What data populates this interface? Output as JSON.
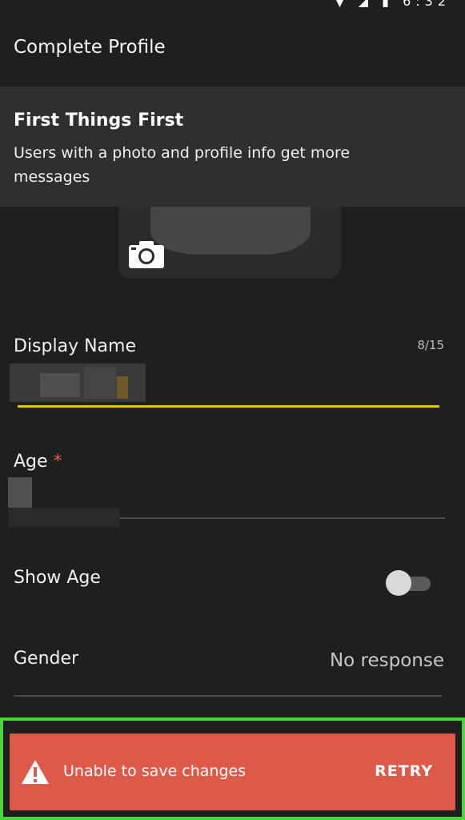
{
  "status_bar": {
    "time": "6:32"
  },
  "header": {
    "title": "Complete Profile"
  },
  "banner": {
    "heading": "First Things First",
    "subtext": "Users with a photo and profile info get more messages"
  },
  "form": {
    "display_name": {
      "label": "Display Name",
      "counter": "8/15"
    },
    "age": {
      "label": "Age",
      "required_mark": "*"
    },
    "show_age": {
      "label": "Show Age",
      "enabled": false
    },
    "gender": {
      "label": "Gender",
      "value": "No response"
    }
  },
  "snackbar": {
    "message": "Unable to save changes",
    "action": "RETRY",
    "background_color": "#dd5a4b"
  },
  "colors": {
    "accent": "#e2c21b",
    "background": "#1f1f21",
    "highlight_outline": "#4bd63a"
  }
}
